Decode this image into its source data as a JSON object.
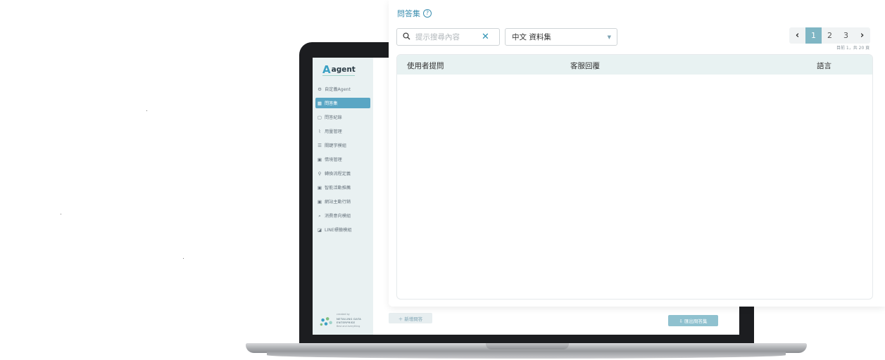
{
  "panel": {
    "title": "問答集",
    "help": "?",
    "search": {
      "placeholder": "提示搜尋內容",
      "icon": "search-icon",
      "clear_glyph": "✕"
    },
    "dataset_select": {
      "value": "中文 資料集",
      "caret": "▼"
    },
    "pagination": {
      "prev": "‹",
      "next": "›",
      "pages": [
        "1",
        "2",
        "3"
      ],
      "active_page": "1",
      "info": "目前 1，共 20 頁"
    },
    "table": {
      "columns": [
        "使用者提問",
        "客服回覆",
        "語言"
      ],
      "rows": []
    }
  },
  "laptop_app": {
    "brand": {
      "mark": "A",
      "name": "agent"
    },
    "sidebar": {
      "items": [
        {
          "label": "自定義Agent",
          "icon": "⚙"
        },
        {
          "label": "問答集",
          "icon": "▦",
          "active": true
        },
        {
          "label": "問答紀錄",
          "icon": "▢"
        },
        {
          "label": "用量管理",
          "icon": "⌇"
        },
        {
          "label": "關鍵字模組",
          "icon": "☰"
        },
        {
          "label": "情境管理",
          "icon": "▣"
        },
        {
          "label": "轉換流程定義",
          "icon": "⚲"
        },
        {
          "label": "智能活動推薦",
          "icon": "▣"
        },
        {
          "label": "網站主動行銷",
          "icon": "▣"
        },
        {
          "label": "消費意向模組",
          "icon": "⌕"
        },
        {
          "label": "LINE標籤模組",
          "icon": "◪"
        }
      ],
      "footer": {
        "small": "created by",
        "title": "NETAILING DATA ENTERPRISE",
        "sub": "Best and everything"
      }
    },
    "add_button": "＋ 新增問答",
    "export_button": "⇩ 匯出問答集"
  },
  "colors": {
    "accent": "#3c8fb0",
    "active_page": "#7fb6c4",
    "table_header": "#e8f2f2",
    "sidebar_bg": "#e9f1f2",
    "sidebar_active": "#5aa6c4"
  }
}
